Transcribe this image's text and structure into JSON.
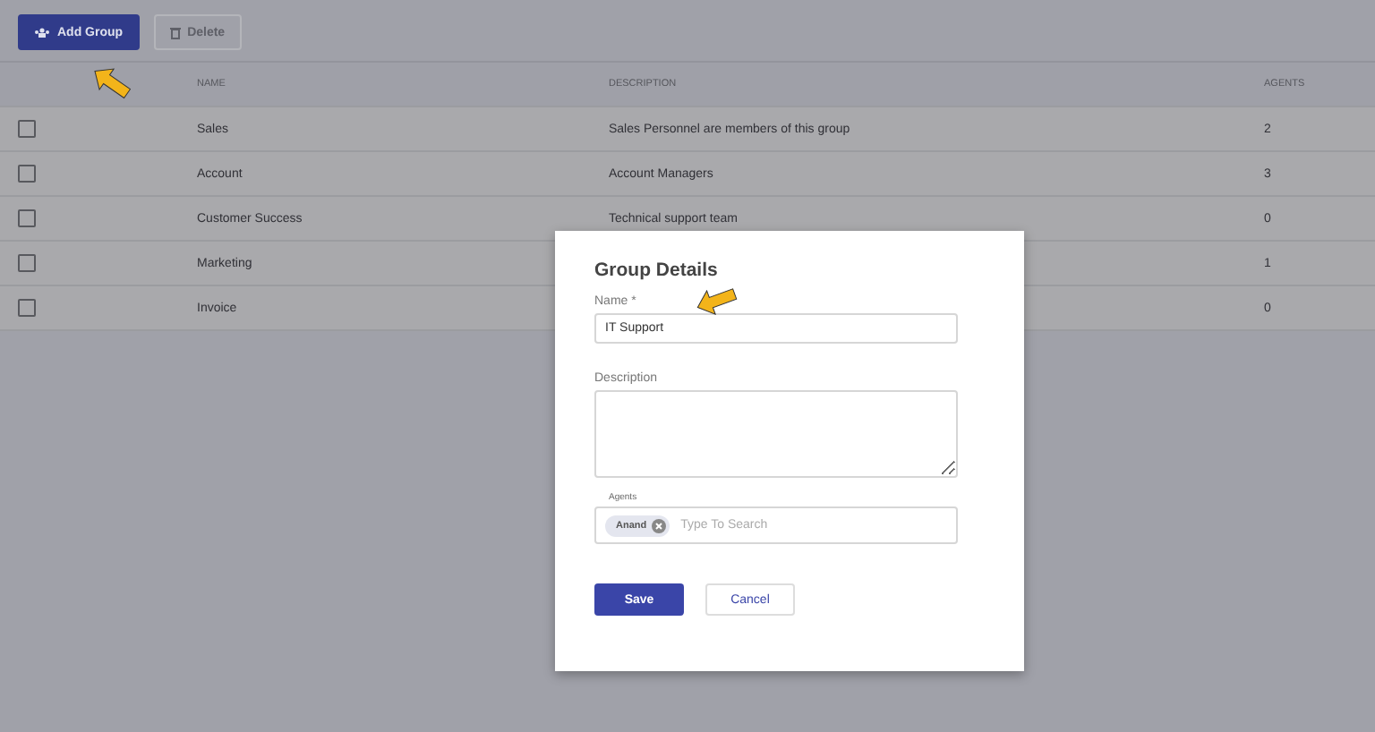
{
  "toolbar": {
    "buttons": [
      {
        "label": "Add Group",
        "disabled": false
      },
      {
        "label": "Delete",
        "disabled": true
      }
    ]
  },
  "table": {
    "columns": [
      "NAME",
      "DESCRIPTION",
      "AGENTS"
    ],
    "rows": [
      {
        "checked": false,
        "name": "Sales",
        "description": "Sales Personnel are members of this group",
        "agents": "2"
      },
      {
        "checked": false,
        "name": "Account",
        "description": "Account Managers",
        "agents": "3"
      },
      {
        "checked": false,
        "name": "Customer Success",
        "description": "Technical support team",
        "agents": "0"
      },
      {
        "checked": false,
        "name": "Marketing",
        "agents": "1"
      },
      {
        "checked": false,
        "name": "Invoice",
        "agents": "0"
      }
    ]
  },
  "dialog": {
    "title": "Group Details",
    "name_label": "Name *",
    "name_value": "IT Support",
    "description_label": "Description",
    "agents_label": "Agents",
    "agents": [
      {
        "name": "Anand"
      }
    ],
    "agents_placeholder": "Type To Search",
    "save": "Save",
    "cancel": "Cancel"
  }
}
